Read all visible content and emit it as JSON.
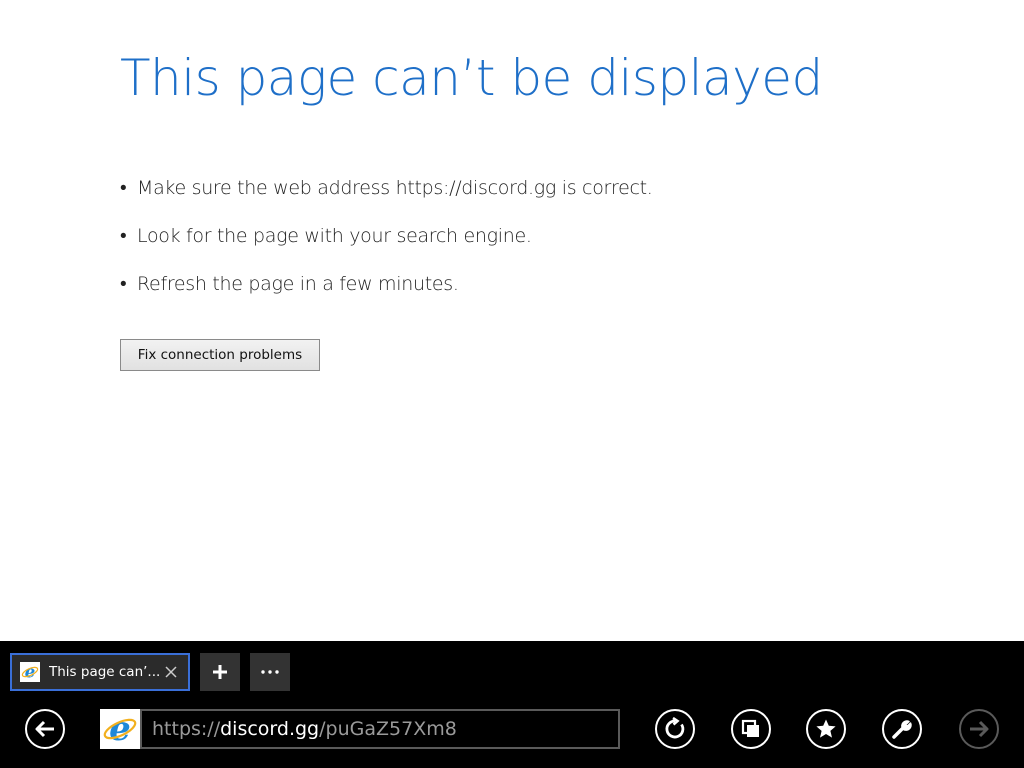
{
  "page": {
    "title": "This page can’t be displayed",
    "tips": [
      "Make sure the web address https://discord.gg is correct.",
      "Look for the page with your search engine.",
      "Refresh the page in a few minutes."
    ],
    "bullet": "•",
    "fix_button_label": "Fix connection problems"
  },
  "tabbar": {
    "active_tab_title": "This page can’...",
    "close_icon": "close-icon",
    "new_tab_icon": "plus-icon",
    "tab_menu_icon": "ellipsis-icon"
  },
  "navbar": {
    "url_prefix": "https://",
    "url_domain": "discord.gg",
    "url_path": "/puGaZ57Xm8",
    "back_icon": "back-arrow-icon",
    "refresh_icon": "refresh-icon",
    "tabs_icon": "tabs-icon",
    "favorites_icon": "star-icon",
    "tools_icon": "wrench-icon",
    "forward_icon": "forward-arrow-icon"
  },
  "colors": {
    "title_blue": "#1e6fc8",
    "appbar_bg": "#000000",
    "tab_border": "#3a6fd8",
    "ie_blue": "#1e88d8"
  }
}
